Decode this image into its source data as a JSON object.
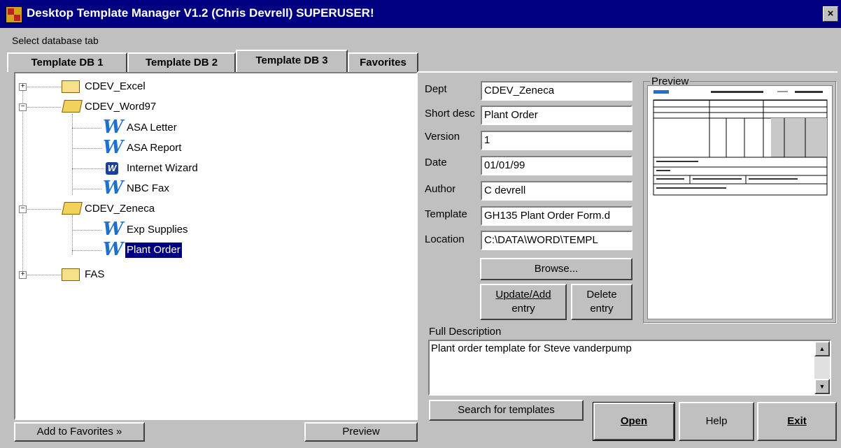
{
  "window": {
    "title": "Desktop Template Manager V1.2    (Chris Devrell)  SUPERUSER!",
    "close_glyph": "×"
  },
  "select_label": "Select database tab",
  "tabs": [
    {
      "label": "Template DB 1",
      "active": false
    },
    {
      "label": "Template DB 2",
      "active": false
    },
    {
      "label": "Template DB 3",
      "active": true
    },
    {
      "label": "Favorites",
      "active": false
    }
  ],
  "tree": [
    {
      "label": "CDEV_Excel",
      "type": "folder",
      "expander": "+"
    },
    {
      "label": "CDEV_Word97",
      "type": "folder-open",
      "expander": "−"
    },
    {
      "label": "ASA Letter",
      "type": "word-icon"
    },
    {
      "label": "ASA Report",
      "type": "word-icon"
    },
    {
      "label": "Internet Wizard",
      "type": "wizard-icon"
    },
    {
      "label": "NBC Fax",
      "type": "word-icon"
    },
    {
      "label": "CDEV_Zeneca",
      "type": "folder-open",
      "expander": "−"
    },
    {
      "label": "Exp Supplies",
      "type": "word-icon"
    },
    {
      "label": "Plant Order",
      "type": "word-icon",
      "selected": true
    },
    {
      "label": "FAS",
      "type": "folder",
      "expander": "+"
    }
  ],
  "form": {
    "dept_label": "Dept",
    "dept_value": "CDEV_Zeneca",
    "short_label": "Short desc",
    "short_value": "Plant Order",
    "version_label": "Version",
    "version_value": "1",
    "date_label": "Date",
    "date_value": "01/01/99",
    "author_label": "Author",
    "author_value": "C devrell",
    "template_label": "Template",
    "template_value": "GH135 Plant Order Form.d",
    "location_label": "Location",
    "location_value": "C:\\DATA\\WORD\\TEMPL"
  },
  "buttons": {
    "browse": "Browse...",
    "update_line1": "Update/Add",
    "update_line2": "entry",
    "delete_line1": "Delete",
    "delete_line2": "entry",
    "search": "Search for templates",
    "open": "Open",
    "help": "Help",
    "exit": "Exit",
    "add_fav": "Add to Favorites »",
    "preview": "Preview"
  },
  "preview_group": "Preview",
  "full_desc_label": "Full Description",
  "full_desc_value": "Plant order template for Steve vanderpump",
  "colors": {
    "titlebar": "#000080",
    "face": "#c0c0c0",
    "selection": "#000080",
    "word_icon": "#1e6fd0"
  }
}
